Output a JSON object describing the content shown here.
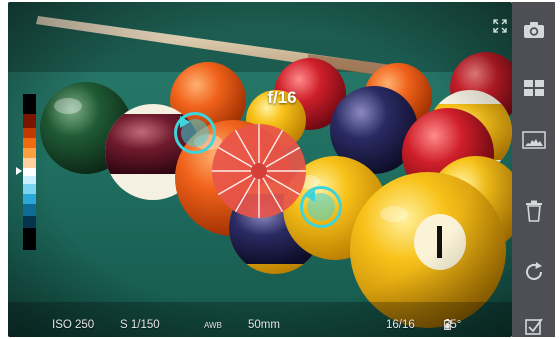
{
  "viewfinder": {
    "aperture_label": "f/16"
  },
  "status_bar": {
    "iso": "ISO 250",
    "shutter": "S  1/150",
    "white_balance": "AWB",
    "focal_length": "50mm",
    "shot_counter": "16/16",
    "battery_temp": "35°"
  },
  "sidebar": {
    "items": [
      {
        "icon": "camera-icon"
      },
      {
        "icon": "grid-icon"
      },
      {
        "icon": "histogram-icon"
      },
      {
        "icon": "trash-icon"
      },
      {
        "icon": "rotate-icon"
      },
      {
        "icon": "checkbox-icon"
      }
    ]
  },
  "colors": {
    "felt": "#1e6b5c",
    "sidebar": "#4d4f55",
    "target": "#3fd3dc",
    "aperture": "#e8554a"
  }
}
